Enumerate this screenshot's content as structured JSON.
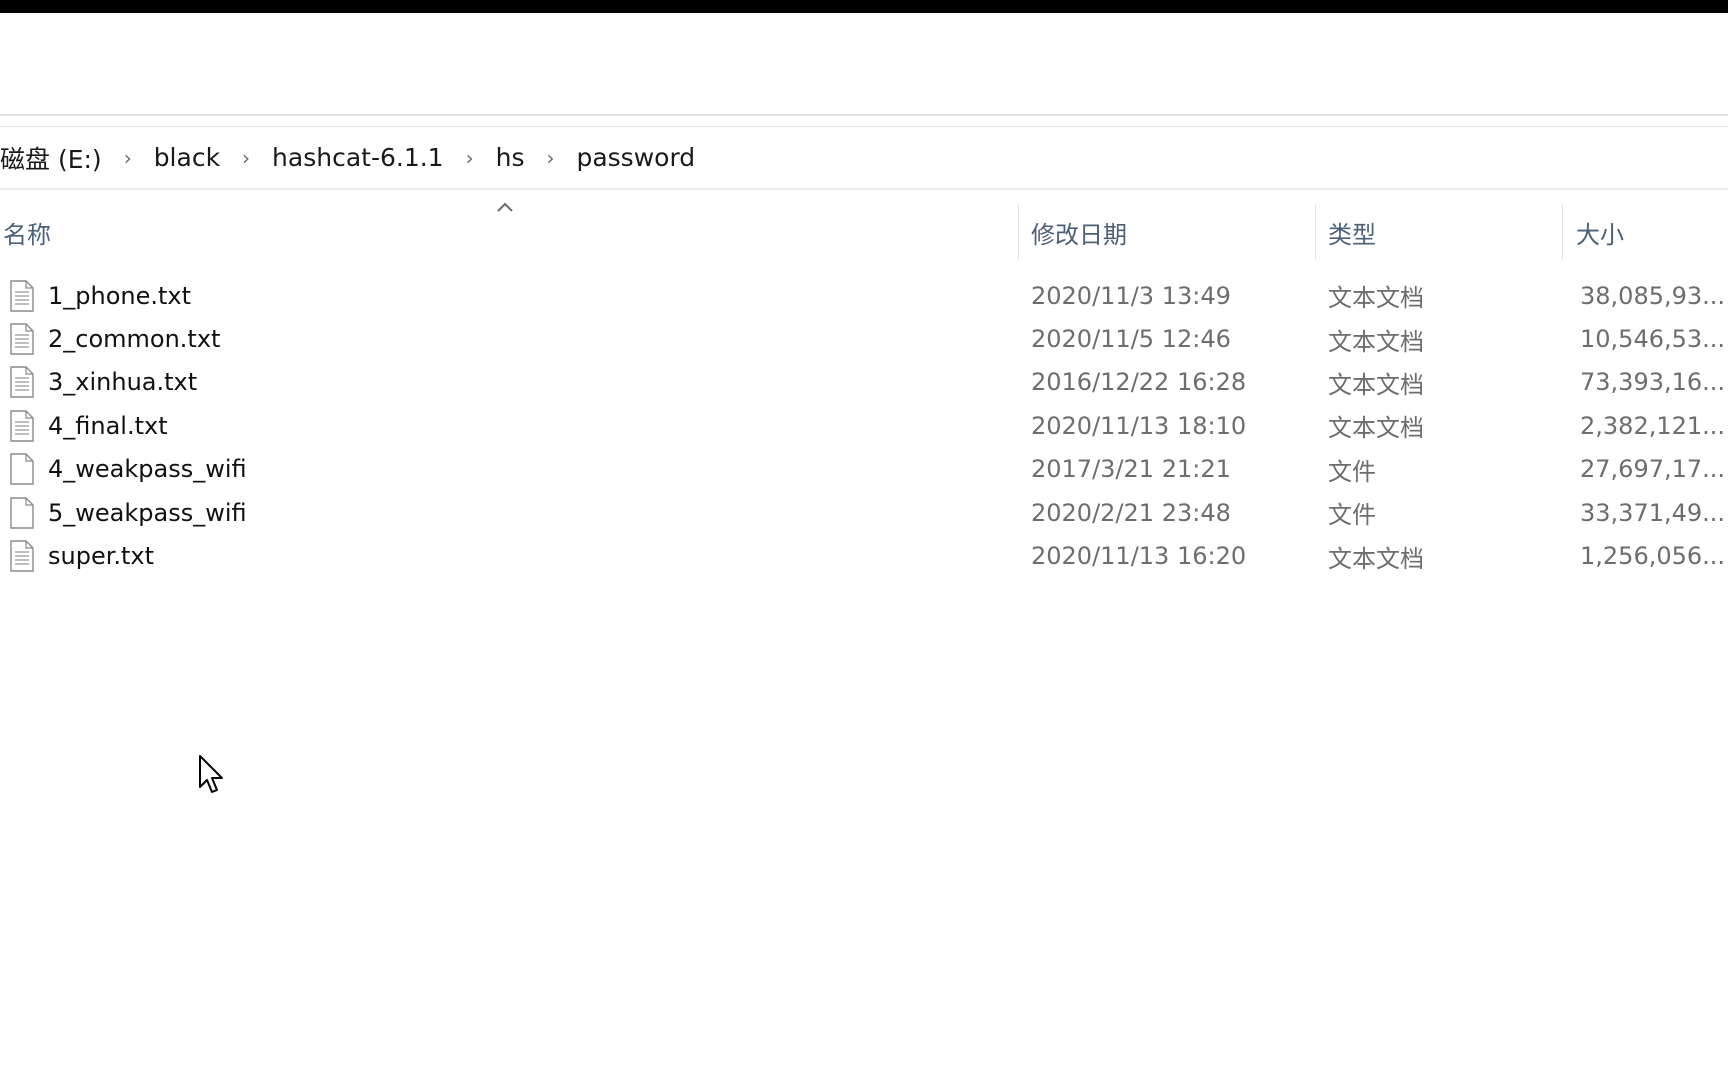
{
  "breadcrumb": {
    "items": [
      {
        "label": "磁盘 (E:)"
      },
      {
        "label": "black"
      },
      {
        "label": "hashcat-6.1.1"
      },
      {
        "label": "hs"
      },
      {
        "label": "password"
      }
    ]
  },
  "columns": {
    "name": "名称",
    "date": "修改日期",
    "type": "类型",
    "size": "大小"
  },
  "files": [
    {
      "name": "1_phone.txt",
      "date": "2020/11/3 13:49",
      "type": "文本文档",
      "size": "38,085,93...",
      "icon": "text-file-icon"
    },
    {
      "name": "2_common.txt",
      "date": "2020/11/5 12:46",
      "type": "文本文档",
      "size": "10,546,53...",
      "icon": "text-file-icon"
    },
    {
      "name": "3_xinhua.txt",
      "date": "2016/12/22 16:28",
      "type": "文本文档",
      "size": "73,393,16...",
      "icon": "text-file-icon"
    },
    {
      "name": "4_final.txt",
      "date": "2020/11/13 18:10",
      "type": "文本文档",
      "size": "2,382,121...",
      "icon": "text-file-icon"
    },
    {
      "name": "4_weakpass_wifi",
      "date": "2017/3/21 21:21",
      "type": "文件",
      "size": "27,697,17...",
      "icon": "blank-file-icon"
    },
    {
      "name": "5_weakpass_wifi",
      "date": "2020/2/21 23:48",
      "type": "文件",
      "size": "33,371,49...",
      "icon": "blank-file-icon"
    },
    {
      "name": "super.txt",
      "date": "2020/11/13 16:20",
      "type": "文本文档",
      "size": "1,256,056...",
      "icon": "text-file-icon"
    }
  ],
  "colors": {
    "header_text": "#4c607a",
    "meta_text": "#6d6d6d",
    "divider": "#e3e3e3"
  }
}
